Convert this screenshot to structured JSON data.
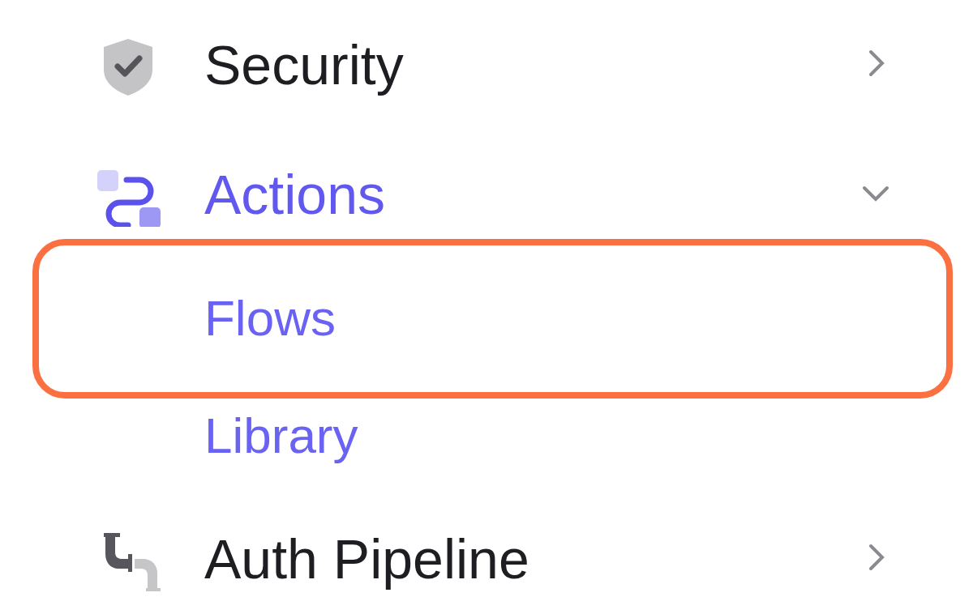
{
  "sidebar": {
    "items": [
      {
        "label": "Security",
        "expanded": false
      },
      {
        "label": "Actions",
        "expanded": true,
        "children": [
          {
            "label": "Flows",
            "highlighted": true
          },
          {
            "label": "Library",
            "highlighted": false
          }
        ]
      },
      {
        "label": "Auth Pipeline",
        "expanded": false
      }
    ]
  }
}
